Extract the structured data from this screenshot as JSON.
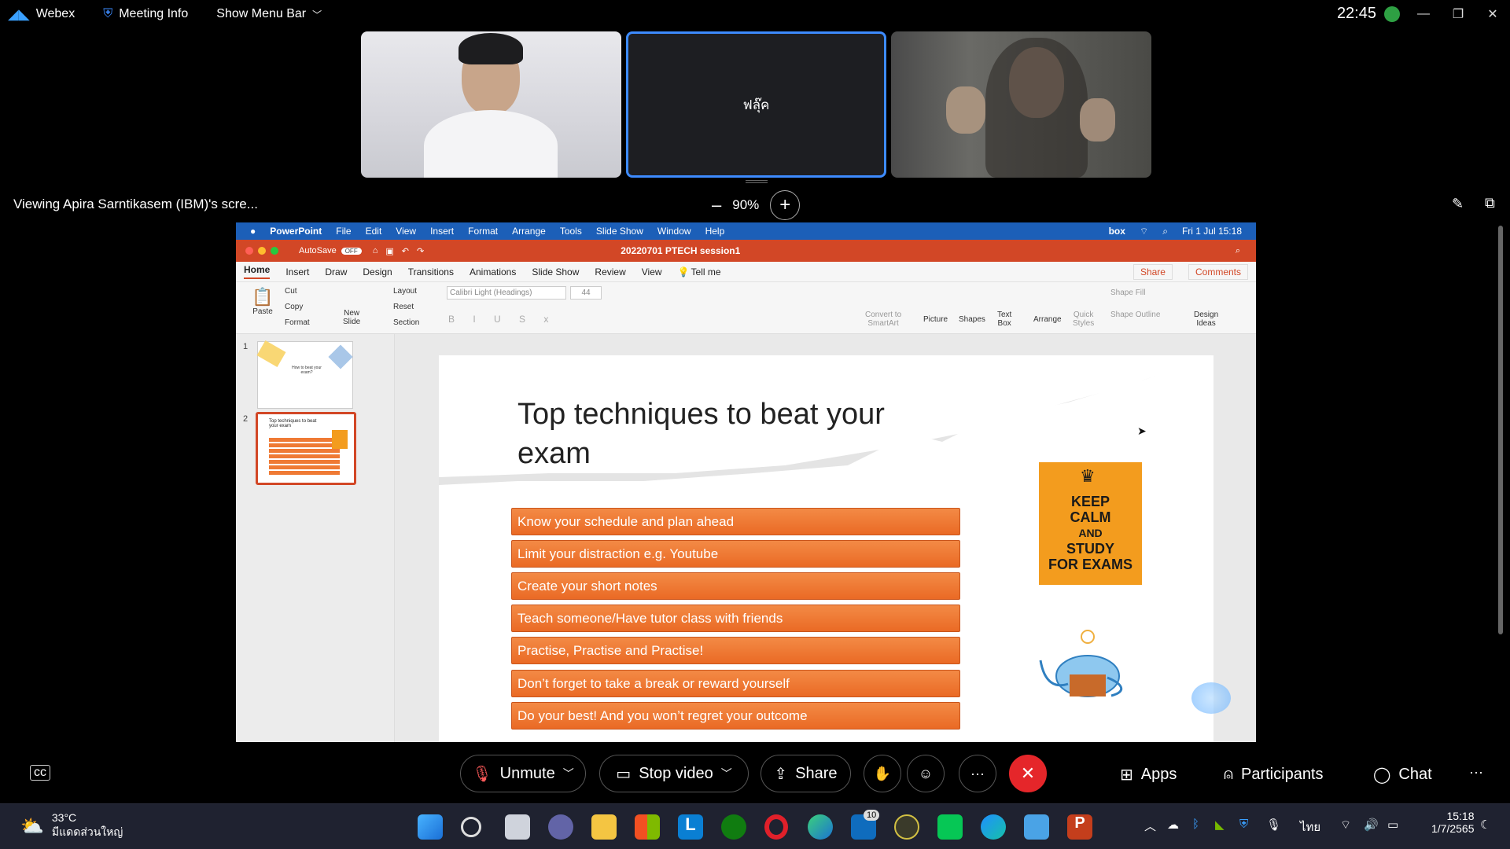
{
  "topbar": {
    "app_name": "Webex",
    "meeting_info": "Meeting Info",
    "show_menu_bar": "Show Menu Bar",
    "time": "22:45"
  },
  "participants": [
    {
      "name": "",
      "has_video": true
    },
    {
      "name": "ฟลุ๊ค",
      "has_video": false
    },
    {
      "name": "",
      "has_video": true
    }
  ],
  "viewing": {
    "label": "Viewing Apira Sarntikasem (IBM)'s scre...",
    "zoom": "90%",
    "zoom_out": "–",
    "zoom_in": "+"
  },
  "mac_menubar": {
    "apple": "",
    "items": [
      "PowerPoint",
      "File",
      "Edit",
      "View",
      "Insert",
      "Format",
      "Arrange",
      "Tools",
      "Slide Show",
      "Window",
      "Help"
    ],
    "right_items": [
      "box"
    ],
    "datetime": "Fri 1 Jul  15:18"
  },
  "powerpoint": {
    "autosave": "AutoSave",
    "autosave_state": "OFF",
    "doc_title": "20220701 PTECH session1",
    "tabs": [
      "Home",
      "Insert",
      "Draw",
      "Design",
      "Transitions",
      "Animations",
      "Slide Show",
      "Review",
      "View"
    ],
    "tell_me": "Tell me",
    "share": "Share",
    "comments": "Comments",
    "ribbon": {
      "paste": "Paste",
      "cut": "Cut",
      "copy": "Copy",
      "format": "Format",
      "new_slide": "New\nSlide",
      "layout": "Layout",
      "reset": "Reset",
      "section": "Section",
      "font": "Calibri Light (Headings)",
      "font_size": "44",
      "convert_smartart": "Convert to\nSmartArt",
      "picture": "Picture",
      "shapes": "Shapes",
      "text_box": "Text\nBox",
      "arrange": "Arrange",
      "quick_styles": "Quick\nStyles",
      "shape_fill": "Shape Fill",
      "shape_outline": "Shape Outline",
      "design_ideas": "Design\nIdeas"
    },
    "thumbnails": [
      {
        "num": "1",
        "title": "How to beat your exam?"
      },
      {
        "num": "2",
        "title": "Top techniques to beat your exam"
      }
    ]
  },
  "slide": {
    "title": "Top techniques to beat your exam",
    "bullets": [
      "Know your schedule and plan ahead",
      "Limit your distraction e.g. Youtube",
      "Create your short notes",
      "Teach someone/Have tutor class with friends",
      "Practise, Practise and Practise!",
      "Don’t forget to take a break or reward yourself",
      "Do your best! And you won’t regret your outcome"
    ],
    "poster": {
      "line1": "KEEP",
      "line2": "CALM",
      "line3": "AND",
      "line4": "STUDY",
      "line5": "FOR EXAMS"
    }
  },
  "controls": {
    "unmute": "Unmute",
    "stop_video": "Stop video",
    "share": "Share",
    "more": "···",
    "apps": "Apps",
    "participants": "Participants",
    "chat": "Chat",
    "overflow": "···"
  },
  "taskbar": {
    "temp": "33°C",
    "weather": "มีแดดส่วนใหญ่",
    "badge": "10",
    "lang": "ไทย",
    "time": "15:18",
    "date": "1/7/2565"
  },
  "colors": {
    "accent": "#3d8bff",
    "slide_orange": "#ea6a25",
    "ppt_red": "#d24726",
    "end_call": "#e5262a"
  }
}
